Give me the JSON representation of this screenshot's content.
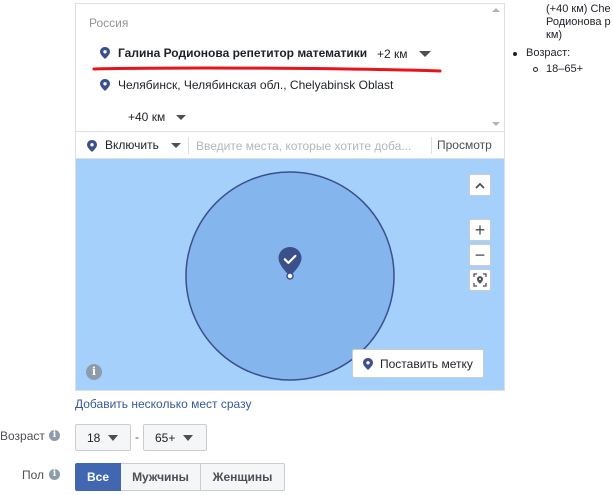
{
  "locations": {
    "country": "Россия",
    "items": [
      {
        "name": "Галина Родионова репетитор математики",
        "radius": "+2 км",
        "icon": "location-pin-icon"
      },
      {
        "name": "Челябинск, Челябинская обл., Chelyabinsk Oblast",
        "radius": "+40 км",
        "icon": "location-pin-icon"
      }
    ]
  },
  "include_bar": {
    "mode_label": "Включить",
    "input_placeholder": "Введите места, которые хотите доба...",
    "browse_label": "Просмотр"
  },
  "map": {
    "drop_pin_label": "Поставить метку",
    "zoom_in": "+",
    "zoom_out": "−",
    "info": "i"
  },
  "bulk_link": "Добавить несколько мест сразу",
  "age": {
    "label": "Возраст",
    "min": "18",
    "max": "65+",
    "dash": "-"
  },
  "gender": {
    "label": "Пол",
    "options": [
      "Все",
      "Мужчины",
      "Женщины"
    ],
    "selected": "Все"
  },
  "summary": {
    "lines": [
      "(+40 км) Che",
      "Родионова р",
      "км)"
    ],
    "age_label": "Возраст:",
    "age_value": "18–65+"
  },
  "colors": {
    "accent": "#4267b2",
    "pin": "#3b4f8a",
    "map_bg": "#a5d0fb",
    "radius_fill": "#7fb0ea",
    "annotation": "#e8141b",
    "link": "#385898"
  }
}
